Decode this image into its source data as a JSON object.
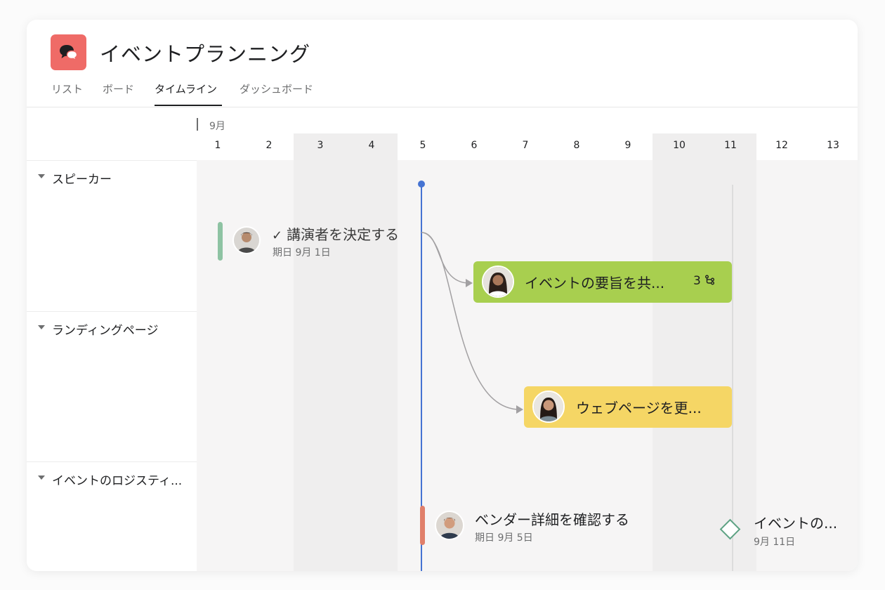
{
  "project": {
    "title": "イベントプランニング"
  },
  "tabs": [
    {
      "label": "リスト"
    },
    {
      "label": "ボード"
    },
    {
      "label": "タイムライン"
    },
    {
      "label": "ダッシュボード"
    }
  ],
  "timeline": {
    "month": "9月",
    "days": [
      "1",
      "2",
      "3",
      "4",
      "5",
      "6",
      "7",
      "8",
      "9",
      "10",
      "11",
      "12",
      "13"
    ]
  },
  "lanes": [
    {
      "name": "スピーカー"
    },
    {
      "name": "ランディングページ"
    },
    {
      "name": "イベントのロジスティ..."
    }
  ],
  "tasks": {
    "decide_speakers": {
      "check": "✓",
      "title": "講演者を決定する",
      "date": "期日 9月 1日"
    },
    "share_summary": {
      "title": "イベントの要旨を共...",
      "subtasks": "3"
    },
    "update_webpage": {
      "title": "ウェブページを更..."
    },
    "vendor_details": {
      "title": "ベンダー詳細を確認する",
      "date": "期日 9月 5日"
    },
    "event_milestone": {
      "title": "イベントの...",
      "date": "9月 11日"
    }
  },
  "colors": {
    "logo": "#ef6b67",
    "today": "#4573d2",
    "green_task": "#a8cf4f",
    "yellow_task": "#f5d665",
    "done_marker": "#8ec3a3",
    "vendor_marker": "#e07f6a",
    "milestone": "#5da283"
  }
}
